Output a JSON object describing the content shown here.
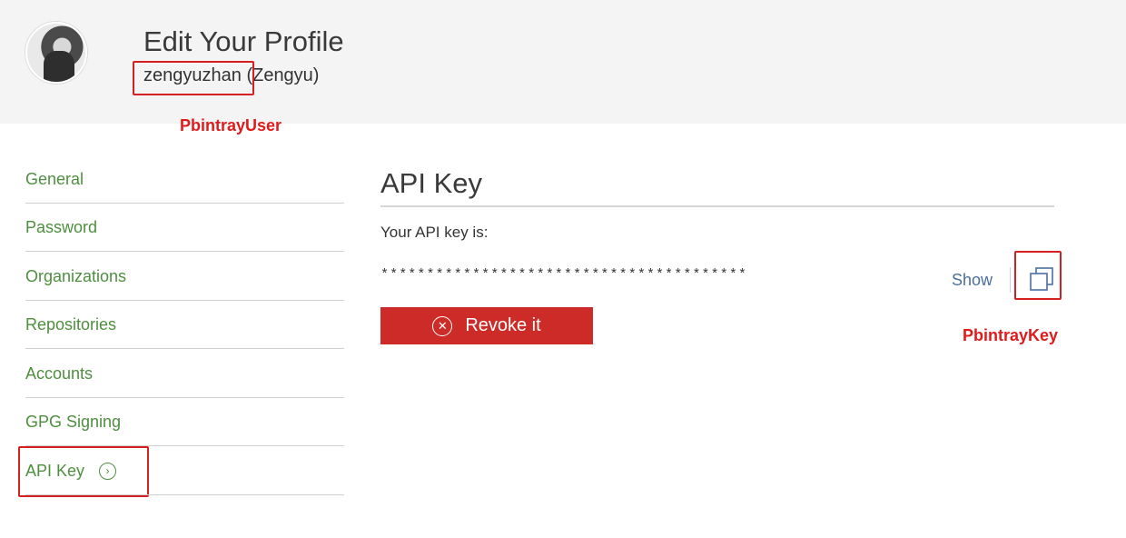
{
  "header": {
    "title": "Edit Your Profile",
    "username": "zengyuzhan",
    "display_name": "(Zengyu)"
  },
  "annotations": {
    "user_label": "PbintrayUser",
    "key_label": "PbintrayKey",
    "color": "#e01b1b"
  },
  "sidebar": {
    "items": [
      {
        "label": "General"
      },
      {
        "label": "Password"
      },
      {
        "label": "Organizations"
      },
      {
        "label": "Repositories"
      },
      {
        "label": "Accounts"
      },
      {
        "label": "GPG Signing"
      },
      {
        "label": "API Key",
        "active": true,
        "icon": "chevron-right-circle-icon"
      }
    ]
  },
  "main": {
    "section_title": "API Key",
    "intro": "Your API key is:",
    "masked_key": "****************************************",
    "show_label": "Show",
    "copy_icon": "copy-icon",
    "revoke_label": "Revoke it",
    "revoke_icon": "close-circle-icon"
  },
  "colors": {
    "header_bg": "#f4f4f4",
    "link_green": "#4d8f3e",
    "link_blue": "#4a6fa0",
    "danger_red": "#cc2b27"
  }
}
